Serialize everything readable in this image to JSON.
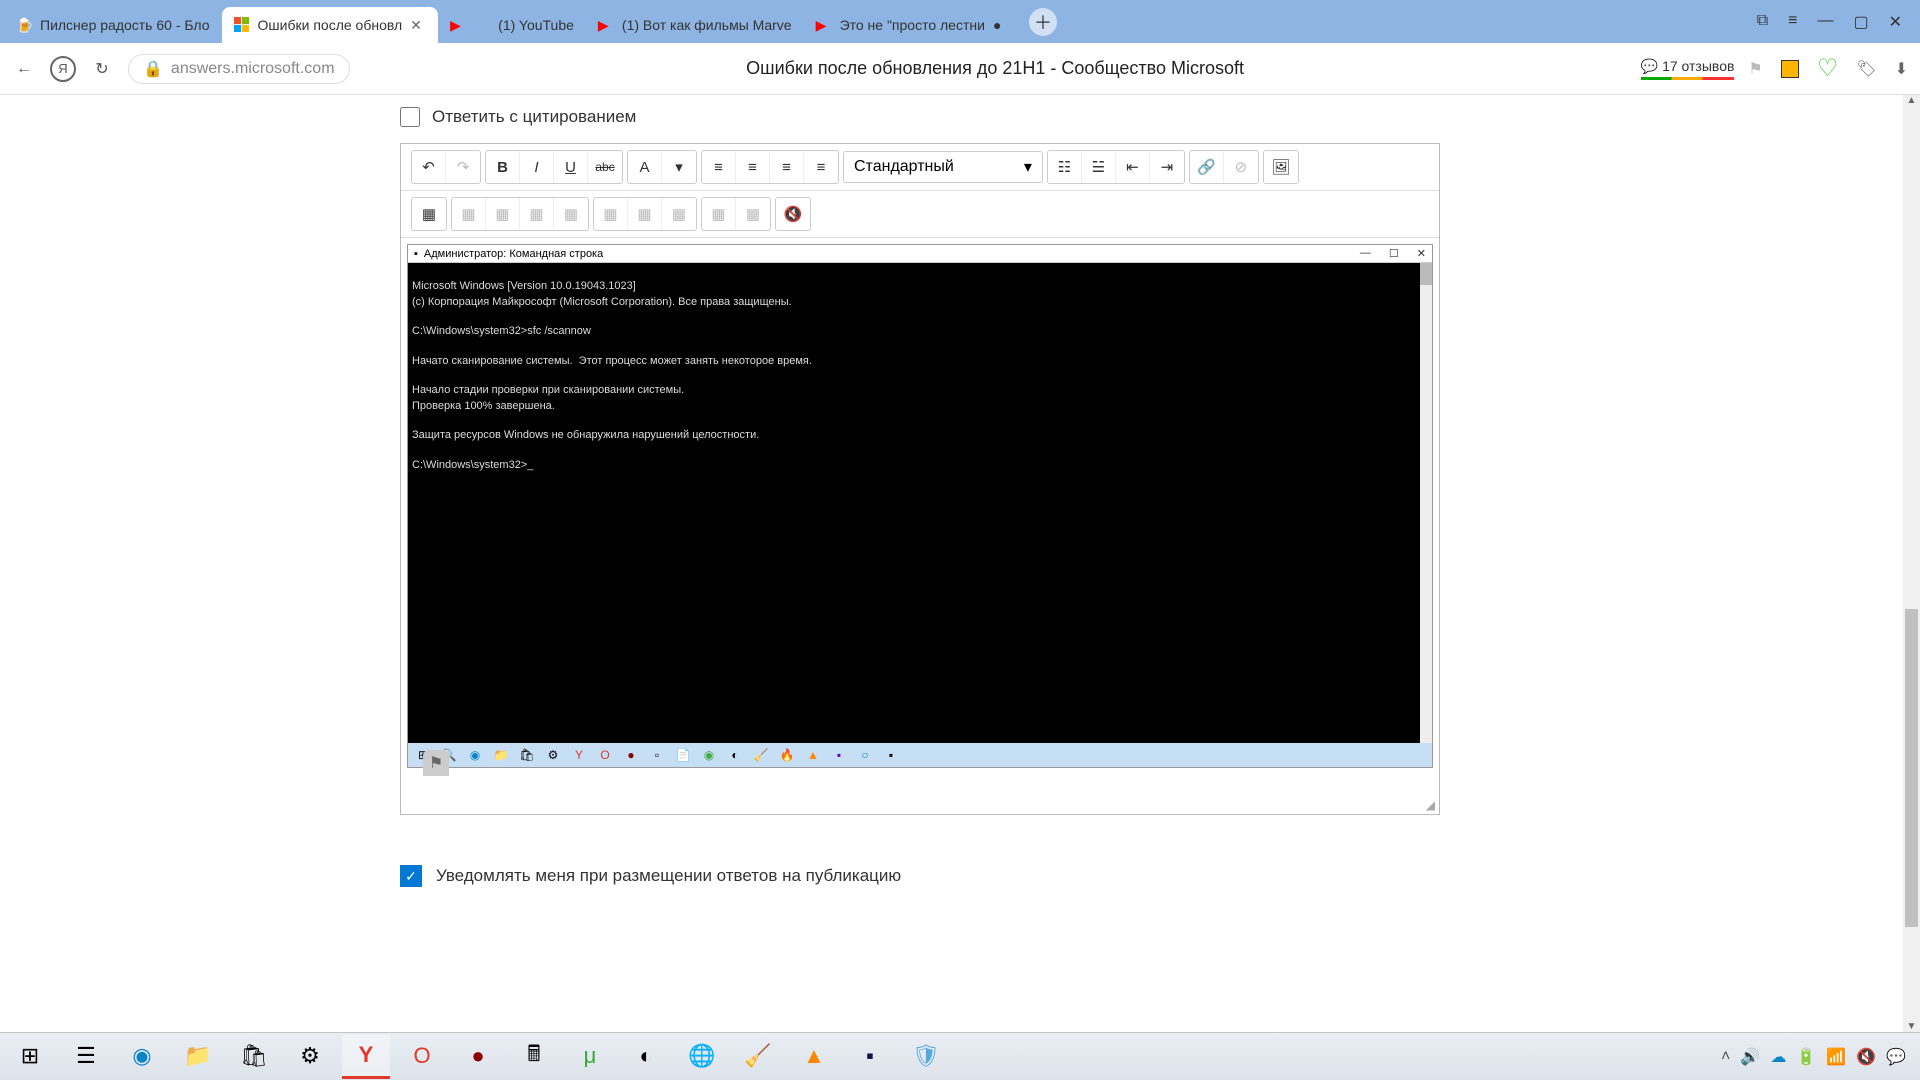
{
  "browser": {
    "tabs": [
      {
        "title": "Пилснер радость 60 - Бло"
      },
      {
        "title": "Ошибки после обновл"
      },
      {
        "title": ""
      },
      {
        "title": "(1) YouTube"
      },
      {
        "title": "(1) Вот как фильмы Marve"
      },
      {
        "title": "Это не \"просто лестни"
      }
    ],
    "active_tab_index": 1,
    "url": "answers.microsoft.com",
    "page_title": "Ошибки после обновления до 21H1 - Сообщество Microsoft",
    "feedback_count": "17 отзывов"
  },
  "page": {
    "quote_checkbox_label": "Ответить с цитированием",
    "quote_checked": false,
    "toolbar_style_select": "Стандартный",
    "notify_checkbox_label": "Уведомлять меня при размещении ответов на публикацию",
    "notify_checked": true
  },
  "cmd": {
    "title": "Администратор: Командная строка",
    "lines": [
      "Microsoft Windows [Version 10.0.19043.1023]",
      "(c) Корпорация Майкрософт (Microsoft Corporation). Все права защищены.",
      "",
      "C:\\Windows\\system32>sfc /scannow",
      "",
      "Начато сканирование системы.  Этот процесс может занять некоторое время.",
      "",
      "Начало стадии проверки при сканировании системы.",
      "Проверка 100% завершена.",
      "",
      "Защита ресурсов Windows не обнаружила нарушений целостности.",
      "",
      "C:\\Windows\\system32>_"
    ]
  }
}
